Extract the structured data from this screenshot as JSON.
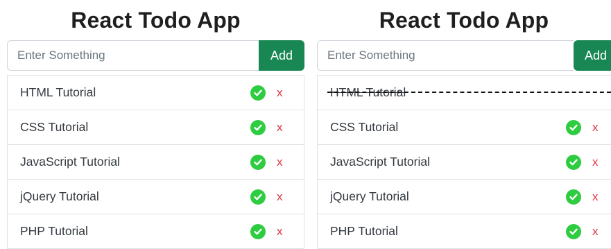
{
  "left": {
    "title": "React Todo App",
    "input_placeholder": "Enter Something",
    "add_label": "Add",
    "todos": [
      {
        "text": "HTML Tutorial",
        "done": false,
        "check_icon": "check-circle-icon",
        "delete_label": "x"
      },
      {
        "text": "CSS Tutorial",
        "done": false,
        "check_icon": "check-circle-icon",
        "delete_label": "x"
      },
      {
        "text": "JavaScript Tutorial",
        "done": false,
        "check_icon": "check-circle-icon",
        "delete_label": "x"
      },
      {
        "text": "jQuery Tutorial",
        "done": false,
        "check_icon": "check-circle-icon",
        "delete_label": "x"
      },
      {
        "text": "PHP Tutorial",
        "done": false,
        "check_icon": "check-circle-icon",
        "delete_label": "x"
      }
    ]
  },
  "right": {
    "title": "React Todo App",
    "input_placeholder": "Enter Something",
    "add_label": "Add",
    "todos": [
      {
        "text": "HTML Tutorial",
        "done": true
      },
      {
        "text": "CSS Tutorial",
        "done": false,
        "check_icon": "check-circle-icon",
        "delete_label": "x"
      },
      {
        "text": "JavaScript Tutorial",
        "done": false,
        "check_icon": "check-circle-icon",
        "delete_label": "x"
      },
      {
        "text": "jQuery Tutorial",
        "done": false,
        "check_icon": "check-circle-icon",
        "delete_label": "x"
      },
      {
        "text": "PHP Tutorial",
        "done": false,
        "check_icon": "check-circle-icon",
        "delete_label": "x"
      }
    ]
  },
  "colors": {
    "add_button": "#198754",
    "check": "#2ecc40",
    "delete": "#dc3545"
  }
}
